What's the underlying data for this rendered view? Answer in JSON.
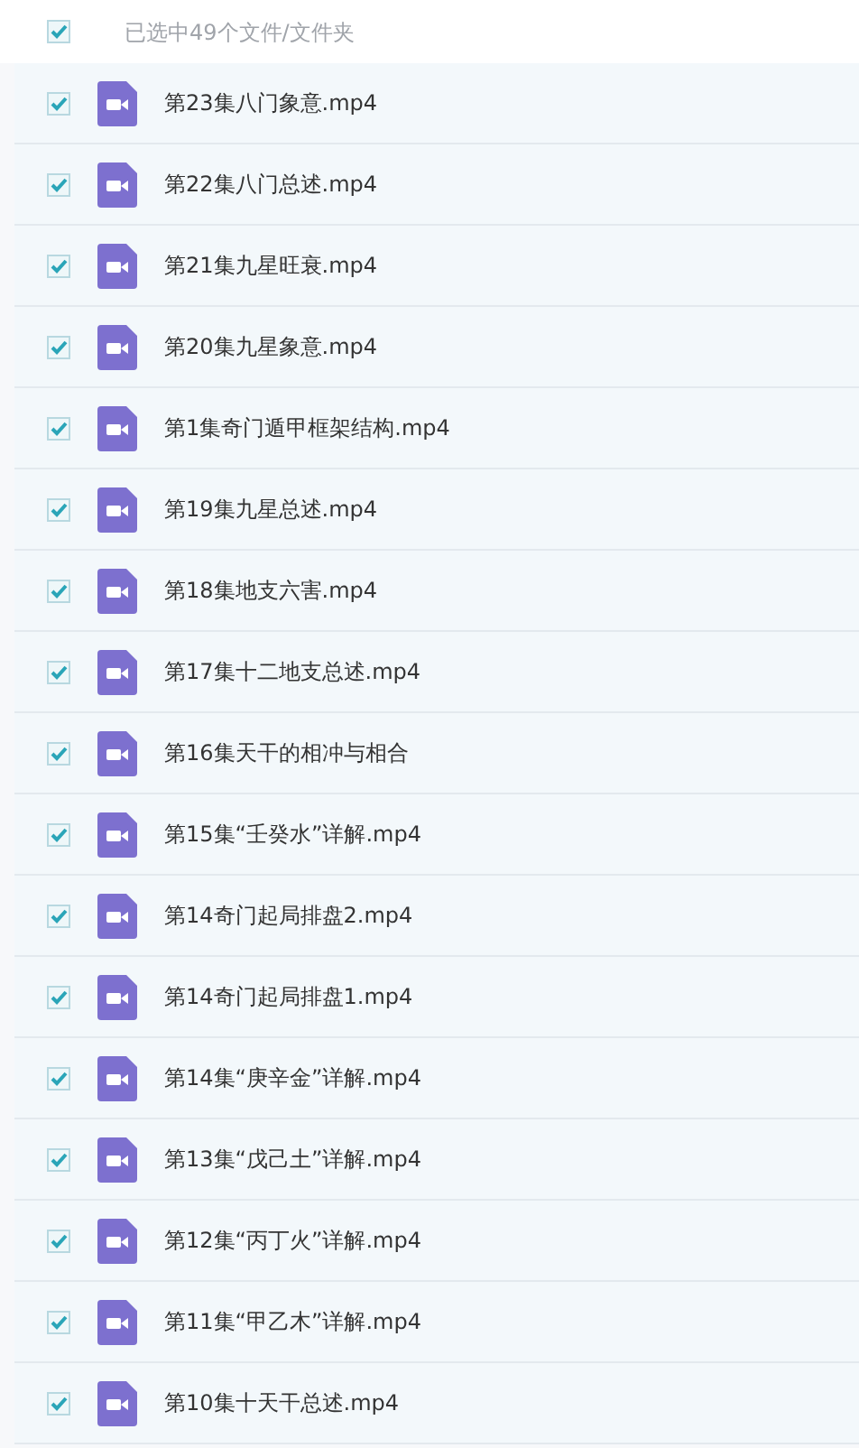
{
  "header": {
    "checked": true,
    "label": "已选中49个文件/文件夹"
  },
  "files": [
    {
      "name": "第23集八门象意.mp4",
      "checked": true
    },
    {
      "name": "第22集八门总述.mp4",
      "checked": true
    },
    {
      "name": "第21集九星旺衰.mp4",
      "checked": true
    },
    {
      "name": "第20集九星象意.mp4",
      "checked": true
    },
    {
      "name": "第1集奇门遁甲框架结构.mp4",
      "checked": true
    },
    {
      "name": "第19集九星总述.mp4",
      "checked": true
    },
    {
      "name": "第18集地支六害.mp4",
      "checked": true
    },
    {
      "name": "第17集十二地支总述.mp4",
      "checked": true
    },
    {
      "name": "第16集天干的相冲与相合",
      "checked": true
    },
    {
      "name": "第15集“壬癸水”详解.mp4",
      "checked": true
    },
    {
      "name": "第14奇门起局排盘2.mp4",
      "checked": true
    },
    {
      "name": "第14奇门起局排盘1.mp4",
      "checked": true
    },
    {
      "name": "第14集“庚辛金”详解.mp4",
      "checked": true
    },
    {
      "name": "第13集“戊己土”详解.mp4",
      "checked": true
    },
    {
      "name": "第12集“丙丁火”详解.mp4",
      "checked": true
    },
    {
      "name": "第11集“甲乙木”详解.mp4",
      "checked": true
    },
    {
      "name": "第10集十天干总述.mp4",
      "checked": true
    }
  ]
}
